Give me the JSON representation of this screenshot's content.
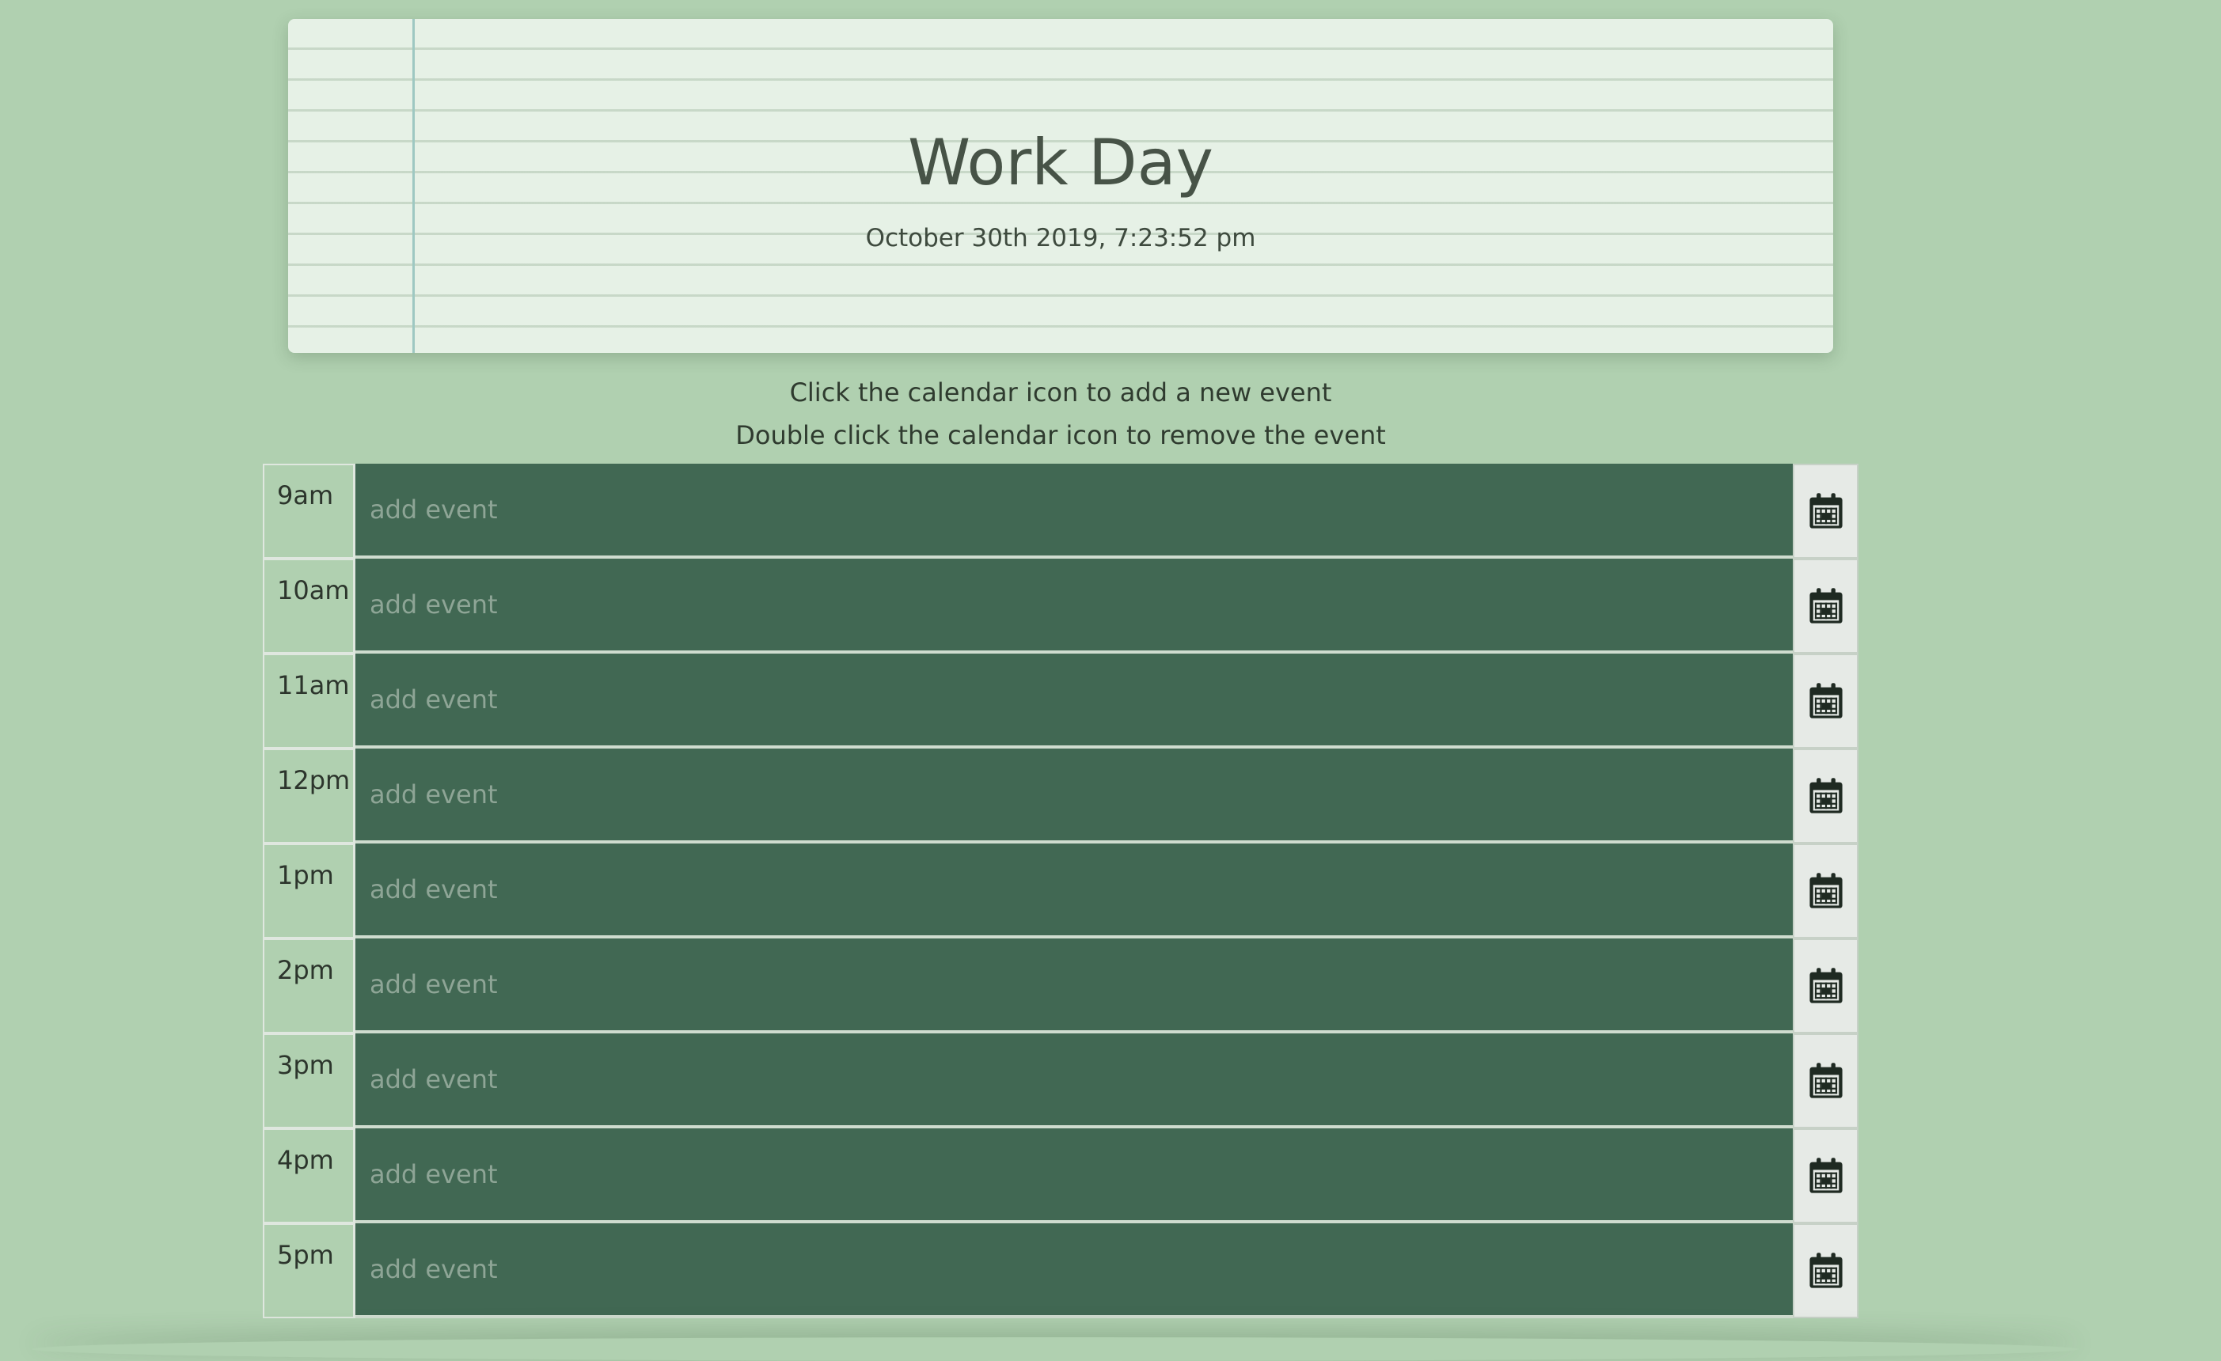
{
  "header": {
    "title": "Work Day",
    "datetime": "October 30th 2019, 7:23:52 pm"
  },
  "instructions": {
    "line1": "Click the calendar icon to add a new event",
    "line2": "Double click the calendar icon to remove the event"
  },
  "schedule": {
    "placeholder": "add event",
    "icon": "calendar-icon",
    "rows": [
      {
        "hour": "9am",
        "value": ""
      },
      {
        "hour": "10am",
        "value": ""
      },
      {
        "hour": "11am",
        "value": ""
      },
      {
        "hour": "12pm",
        "value": ""
      },
      {
        "hour": "1pm",
        "value": ""
      },
      {
        "hour": "2pm",
        "value": ""
      },
      {
        "hour": "3pm",
        "value": ""
      },
      {
        "hour": "4pm",
        "value": ""
      },
      {
        "hour": "5pm",
        "value": ""
      }
    ]
  },
  "colors": {
    "page_background": "#b0d0b0",
    "event_row": "#416853",
    "header_paper": "#e6f1e6",
    "margin_line": "#9ec8c2",
    "calendar_button": "#e6eae6"
  }
}
